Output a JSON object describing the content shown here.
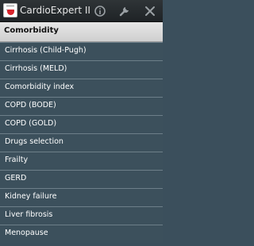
{
  "app": {
    "title": "CardioExpert II"
  },
  "icons": {
    "app_icon": "cardio-app-icon",
    "info": "info-icon",
    "settings": "wrench-icon",
    "close": "close-icon"
  },
  "section": {
    "header": "Comorbidity"
  },
  "items": [
    {
      "label": "Cirrhosis (Child-Pugh)"
    },
    {
      "label": "Cirrhosis (MELD)"
    },
    {
      "label": "Comorbidity index"
    },
    {
      "label": "COPD (BODE)"
    },
    {
      "label": "COPD (GOLD)"
    },
    {
      "label": "Drugs selection"
    },
    {
      "label": "Frailty"
    },
    {
      "label": "GERD"
    },
    {
      "label": "Kidney failure"
    },
    {
      "label": "Liver fibrosis"
    },
    {
      "label": "Menopause"
    }
  ],
  "colors": {
    "titlebar": "#23282b",
    "list_bg": "#3c505c",
    "divider": "#6d7f89",
    "header_bg": "#dcdcdc"
  }
}
